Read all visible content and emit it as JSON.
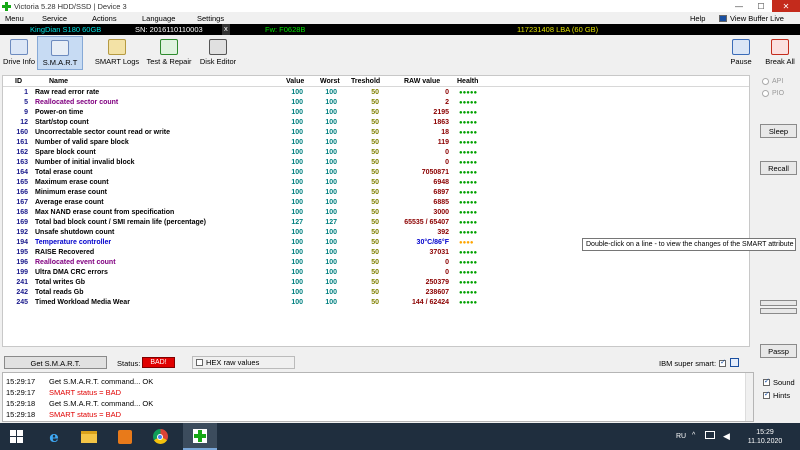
{
  "window": {
    "title": "Victoria 5.28 HDD/SSD | Device 3",
    "icon": "green-cross-icon"
  },
  "menu": {
    "items": [
      "Menu",
      "Service",
      "Actions",
      "Language",
      "Settings"
    ],
    "help": "Help",
    "view_buffer": "View Buffer Live"
  },
  "drive_info": {
    "model": "KingDian S180 60GB",
    "serial": "SN: 2016110110003",
    "close": "x",
    "firmware": "Fw: F0628B",
    "capacity": "117231408 LBA (60 GB)"
  },
  "toolbar": {
    "drive_info": "Drive Info",
    "smart": "S.M.A.R.T",
    "smart_logs": "SMART Logs",
    "test_repair": "Test & Repair",
    "disk_editor": "Disk Editor",
    "pause": "Pause",
    "break_all": "Break All"
  },
  "table": {
    "headers": [
      "ID",
      "Name",
      "Value",
      "Worst",
      "Treshold",
      "RAW value",
      "Health"
    ],
    "rows": [
      {
        "id": "1",
        "name": "Raw read error rate",
        "value": "100",
        "worst": "100",
        "thr": "50",
        "raw": "0",
        "health": "●●●●●",
        "style": "normal"
      },
      {
        "id": "5",
        "name": "Reallocated sector count",
        "value": "100",
        "worst": "100",
        "thr": "50",
        "raw": "2",
        "health": "●●●●●",
        "style": "warn"
      },
      {
        "id": "9",
        "name": "Power-on time",
        "value": "100",
        "worst": "100",
        "thr": "50",
        "raw": "2195",
        "health": "●●●●●",
        "style": "normal"
      },
      {
        "id": "12",
        "name": "Start/stop count",
        "value": "100",
        "worst": "100",
        "thr": "50",
        "raw": "1863",
        "health": "●●●●●",
        "style": "normal"
      },
      {
        "id": "160",
        "name": "Uncorrectable sector count read or write",
        "value": "100",
        "worst": "100",
        "thr": "50",
        "raw": "18",
        "health": "●●●●●",
        "style": "normal"
      },
      {
        "id": "161",
        "name": "Number of valid spare block",
        "value": "100",
        "worst": "100",
        "thr": "50",
        "raw": "119",
        "health": "●●●●●",
        "style": "normal"
      },
      {
        "id": "162",
        "name": "Spare block count",
        "value": "100",
        "worst": "100",
        "thr": "50",
        "raw": "0",
        "health": "●●●●●",
        "style": "normal"
      },
      {
        "id": "163",
        "name": "Number of initial invalid block",
        "value": "100",
        "worst": "100",
        "thr": "50",
        "raw": "0",
        "health": "●●●●●",
        "style": "normal"
      },
      {
        "id": "164",
        "name": "Total erase count",
        "value": "100",
        "worst": "100",
        "thr": "50",
        "raw": "7050871",
        "health": "●●●●●",
        "style": "normal"
      },
      {
        "id": "165",
        "name": "Maximum erase count",
        "value": "100",
        "worst": "100",
        "thr": "50",
        "raw": "6948",
        "health": "●●●●●",
        "style": "normal"
      },
      {
        "id": "166",
        "name": "Minimum erase count",
        "value": "100",
        "worst": "100",
        "thr": "50",
        "raw": "6897",
        "health": "●●●●●",
        "style": "normal"
      },
      {
        "id": "167",
        "name": "Average erase count",
        "value": "100",
        "worst": "100",
        "thr": "50",
        "raw": "6885",
        "health": "●●●●●",
        "style": "normal"
      },
      {
        "id": "168",
        "name": "Max NAND erase count from specification",
        "value": "100",
        "worst": "100",
        "thr": "50",
        "raw": "3000",
        "health": "●●●●●",
        "style": "normal"
      },
      {
        "id": "169",
        "name": "Total bad block count / SMI remain life (percentage)",
        "value": "127",
        "worst": "127",
        "thr": "50",
        "raw": "65535 / 65407",
        "health": "●●●●●",
        "style": "normal"
      },
      {
        "id": "192",
        "name": "Unsafe shutdown count",
        "value": "100",
        "worst": "100",
        "thr": "50",
        "raw": "392",
        "health": "●●●●●",
        "style": "normal"
      },
      {
        "id": "194",
        "name": "Temperature controller",
        "value": "100",
        "worst": "100",
        "thr": "50",
        "raw": "30°C/86°F",
        "health": "●●●●",
        "style": "temp"
      },
      {
        "id": "195",
        "name": "RAISE Recovered",
        "value": "100",
        "worst": "100",
        "thr": "50",
        "raw": "37031",
        "health": "●●●●●",
        "style": "normal"
      },
      {
        "id": "196",
        "name": "Reallocated event count",
        "value": "100",
        "worst": "100",
        "thr": "50",
        "raw": "0",
        "health": "●●●●●",
        "style": "warn"
      },
      {
        "id": "199",
        "name": "Ultra DMA CRC errors",
        "value": "100",
        "worst": "100",
        "thr": "50",
        "raw": "0",
        "health": "●●●●●",
        "style": "normal"
      },
      {
        "id": "241",
        "name": "Total writes Gb",
        "value": "100",
        "worst": "100",
        "thr": "50",
        "raw": "250379",
        "health": "●●●●●",
        "style": "normal"
      },
      {
        "id": "242",
        "name": "Total reads Gb",
        "value": "100",
        "worst": "100",
        "thr": "50",
        "raw": "238607",
        "health": "●●●●●",
        "style": "normal"
      },
      {
        "id": "245",
        "name": "Timed Workload Media Wear",
        "value": "100",
        "worst": "100",
        "thr": "50",
        "raw": "144 / 62424",
        "health": "●●●●●",
        "style": "normal"
      }
    ]
  },
  "tooltip": "Double-click on a line - to view the changes of the SMART attribute",
  "side": {
    "api": "API",
    "pio": "PIO",
    "sleep": "Sleep",
    "recall": "Recall",
    "passp": "Passp"
  },
  "bottom": {
    "get_smart": "Get S.M.A.R.T.",
    "status_label": "Status:",
    "status_value": "BAD!",
    "hex_raw": "HEX raw values",
    "ibm_super_smart": "IBM super smart:"
  },
  "log": [
    {
      "time": "15:29:17",
      "msg": "Get S.M.A.R.T. command... OK",
      "kind": "normal"
    },
    {
      "time": "15:29:17",
      "msg": "SMART status = BAD",
      "kind": "red"
    },
    {
      "time": "15:29:18",
      "msg": "Get S.M.A.R.T. command... OK",
      "kind": "normal"
    },
    {
      "time": "15:29:18",
      "msg": "SMART status = BAD",
      "kind": "red"
    }
  ],
  "log_options": {
    "sound": "Sound",
    "hints": "Hints"
  },
  "taskbar": {
    "lang": "RU",
    "time": "15:29",
    "date": "11.10.2020"
  },
  "colors": {
    "status_bad": "#e00000",
    "health_green": "#00a000",
    "health_orange": "#ffa500"
  }
}
